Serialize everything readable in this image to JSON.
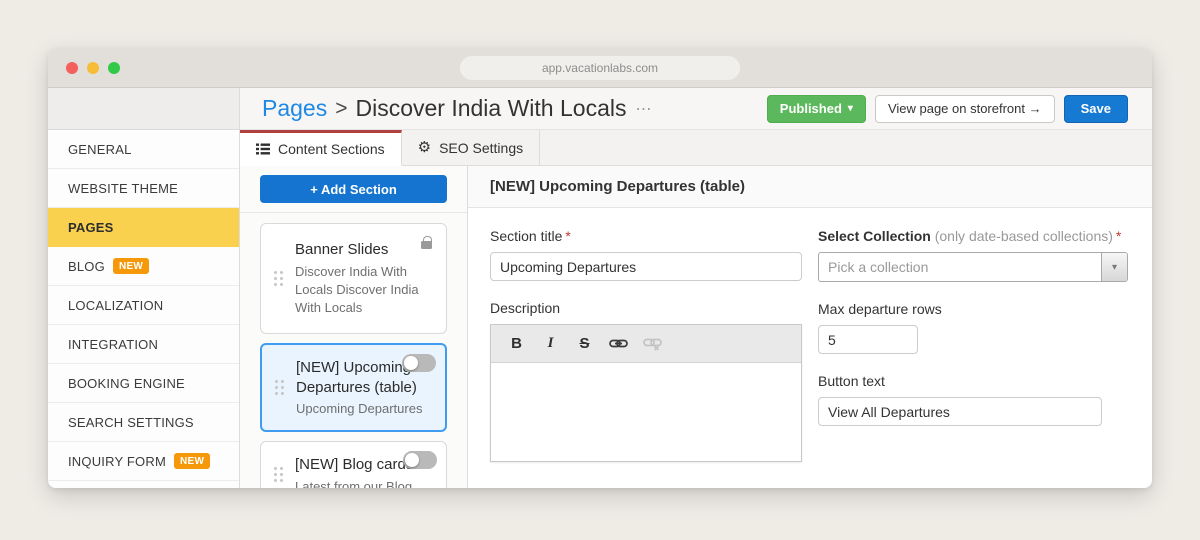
{
  "browser": {
    "url": "app.vacationlabs.com"
  },
  "header": {
    "breadcrumb_root": "Pages",
    "separator": ">",
    "page_title": "Discover India With Locals",
    "overflow_ellipsis": "⋯",
    "published_label": "Published",
    "view_storefront_label": "View page on storefront →",
    "save_label": "Save"
  },
  "icons": {
    "published_caret": "▾",
    "select_caret": "▾",
    "gear": "⚙"
  },
  "colors": {
    "accent_blue": "#1679d2",
    "link_blue": "#1e88e5",
    "published_green": "#5cb85c",
    "sidebar_active_yellow": "#f9d14e",
    "badge_orange": "#f5990b",
    "active_tab_red": "#b2423f",
    "selected_card_blue": "#3f9cf0"
  },
  "sidebar": {
    "items": [
      {
        "label": "GENERAL"
      },
      {
        "label": "WEBSITE THEME"
      },
      {
        "label": "PAGES",
        "active": true
      },
      {
        "label": "BLOG",
        "badge": "NEW"
      },
      {
        "label": "LOCALIZATION"
      },
      {
        "label": "INTEGRATION"
      },
      {
        "label": "BOOKING ENGINE"
      },
      {
        "label": "SEARCH SETTINGS"
      },
      {
        "label": "INQUIRY FORM",
        "badge": "NEW"
      }
    ]
  },
  "tabs": {
    "content_sections": "Content Sections",
    "seo_settings": "SEO Settings"
  },
  "sections_panel": {
    "add_section_label": "+ Add Section",
    "cards": [
      {
        "title": "Banner Slides",
        "subtitle": "Discover India With Locals Discover India With Locals",
        "locked": true
      },
      {
        "title": "[NEW] Upcoming Departures (table)",
        "subtitle": "Upcoming Departures",
        "selected": true,
        "toggle": "off"
      },
      {
        "title": "[NEW] Blog cards",
        "subtitle": "Latest from our Blog",
        "toggle": "off"
      }
    ]
  },
  "form": {
    "heading": "[NEW] Upcoming Departures (table)",
    "required_mark": "*",
    "section_title": {
      "label": "Section title",
      "value": "Upcoming Departures"
    },
    "select_collection": {
      "label": "Select Collection",
      "hint": "(only date-based collections)",
      "placeholder": "Pick a collection"
    },
    "description": {
      "label": "Description",
      "toolbar": {
        "bold": "B",
        "italic": "I",
        "strike": "S"
      }
    },
    "max_rows": {
      "label": "Max departure rows",
      "value": "5"
    },
    "button_text": {
      "label": "Button text",
      "value": "View All Departures"
    }
  }
}
